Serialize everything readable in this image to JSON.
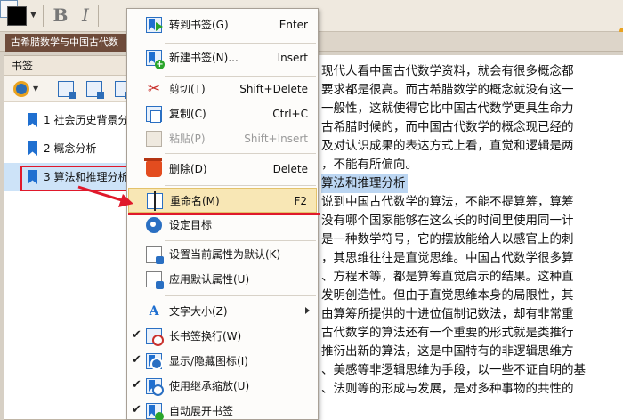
{
  "toolbar": {
    "bold_label": "B",
    "italic_label": "I"
  },
  "document": {
    "tab_title": "古希腊数学与中国古代数"
  },
  "bookmarks_panel": {
    "title": "书签",
    "items": [
      {
        "label": "1 社会历史背景分"
      },
      {
        "label": "2 概念分析"
      },
      {
        "label": "3 算法和推理分析"
      }
    ],
    "selected_index": 2
  },
  "page_text": {
    "lines": [
      "现代人看中国古代数学资料，就会有很多概念都",
      "要求都是很高。而古希腊数学的概念就没有这一",
      "一般性，这就使得它比中国古代数学更具生命力",
      "古希腊时候的，而中国古代数学的概念现已经的",
      "及对认识成果的表达方式上看，直觉和逻辑是两",
      "，不能有所偏向。",
      "算法和推理分析",
      "说到中国古代数学的算法，不能不提算筹，算筹",
      "没有哪个国家能够在这么长的时间里使用同一计",
      "是一种数学符号，它的摆放能给人以感官上的刺",
      "，其思维往往是直觉思维。中国古代数学很多算",
      "、方程术等，都是算筹直觉启示的结果。这种直",
      "发明创造性。但由于直觉思维本身的局限性，其",
      "由算筹所提供的十进位值制记数法，却有非常重",
      "古代数学的算法还有一个重要的形式就是类推行",
      "推衍出新的算法，这是中国特有的非逻辑思维方",
      "、美感等非逻辑思维为手段，以一些不证自明的基",
      "、法则等的形成与发展，是对多种事物的共性的",
      "  "
    ],
    "highlighted_line_index": 6
  },
  "context_menu": {
    "items": [
      {
        "label": "转到书签(G)",
        "shortcut": "Enter",
        "icon": "goto-bookmark-icon"
      },
      {
        "label": "新建书签(N)...",
        "shortcut": "Insert",
        "icon": "new-bookmark-icon"
      },
      {
        "label": "剪切(T)",
        "shortcut": "Shift+Delete",
        "icon": "scissors-icon"
      },
      {
        "label": "复制(C)",
        "shortcut": "Ctrl+C",
        "icon": "copy-icon"
      },
      {
        "label": "粘贴(P)",
        "shortcut": "Shift+Insert",
        "icon": "paste-icon",
        "disabled": true
      },
      {
        "label": "删除(D)",
        "shortcut": "Delete",
        "icon": "trash-icon"
      },
      {
        "label": "重命名(M)",
        "shortcut": "F2",
        "icon": "rename-icon",
        "hovered": true
      },
      {
        "label": "设定目标",
        "shortcut": "",
        "icon": "target-icon"
      },
      {
        "label": "设置当前属性为默认(K)",
        "shortcut": "",
        "icon": "set-default-icon"
      },
      {
        "label": "应用默认属性(U)",
        "shortcut": "",
        "icon": "apply-default-icon"
      },
      {
        "label": "文字大小(Z)",
        "shortcut": "",
        "icon": "font-size-icon",
        "submenu": true
      },
      {
        "label": "长书签换行(W)",
        "shortcut": "",
        "icon": "wrap-icon",
        "checked": true
      },
      {
        "label": "显示/隐藏图标(I)",
        "shortcut": "",
        "icon": "show-hide-icon",
        "checked": true
      },
      {
        "label": "使用继承缩放(U)",
        "shortcut": "",
        "icon": "inherit-zoom-icon",
        "checked": true
      },
      {
        "label": "自动展开书签",
        "shortcut": "",
        "icon": "auto-expand-icon",
        "checked": true
      }
    ]
  },
  "annotations": {
    "accent_color": "#e0192b",
    "highlight_color": "#bcd6f2",
    "hover_color": "#f8e7b5"
  }
}
